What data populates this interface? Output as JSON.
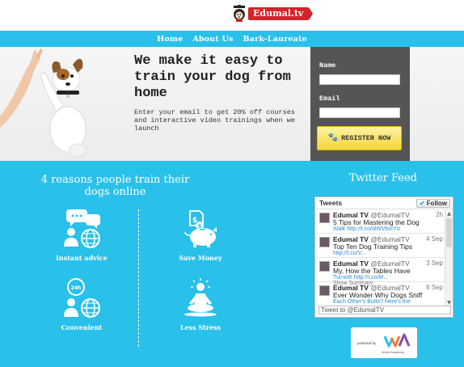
{
  "brand": {
    "logo_text": "Edumal.tv"
  },
  "nav": {
    "items": [
      "Home",
      "About Us",
      "Bark-Laureate"
    ]
  },
  "hero": {
    "title": "We make it easy to train your dog from home",
    "subtitle": "Enter your email to get 20% off courses and interactive video trainings when we launch",
    "form": {
      "name_label": "Name",
      "email_label": "Email",
      "register_label": "REGISTER NOW"
    }
  },
  "reasons": {
    "title": "4 reasons people train their dogs online",
    "items": [
      {
        "label": "Instant advice",
        "icon": "chat-globe-icon"
      },
      {
        "label": "Save Money",
        "icon": "piggy-bank-icon"
      },
      {
        "label": "Convenient",
        "icon": "clock-globe-icon"
      },
      {
        "label": "Less Stress",
        "icon": "meditation-icon"
      }
    ]
  },
  "twitter": {
    "title": "Twitter Feed",
    "header": "Tweets",
    "follow_label": "Follow",
    "compose_placeholder": "Tweet to @EdumalTV",
    "tweets": [
      {
        "name": "Edumal TV",
        "handle": "@EdumalTV",
        "date": "2h",
        "text": "5 Tips for Mastering the Dog",
        "link": "Walk http://t.co/i8WVbxrYb"
      },
      {
        "name": "Edumal TV",
        "handle": "@EdumalTV",
        "date": "4 Sep",
        "text": "Top Ten Dog Training Tips",
        "link": "http://t.co/V..."
      },
      {
        "name": "Edumal TV",
        "handle": "@EdumalTV",
        "date": "3 Sep",
        "text": "My, How the Tables Have",
        "link": "Turned! http://t.co/M...",
        "extra": "Show Summary"
      },
      {
        "name": "Edumal TV",
        "handle": "@EdumalTV",
        "date": "6 Sep",
        "text": "Ever Wonder Why Dogs Sniff",
        "link": "Each Other's Butts? Here's the"
      }
    ]
  },
  "powered_by": {
    "label": "powered by",
    "name": "World Academy"
  }
}
